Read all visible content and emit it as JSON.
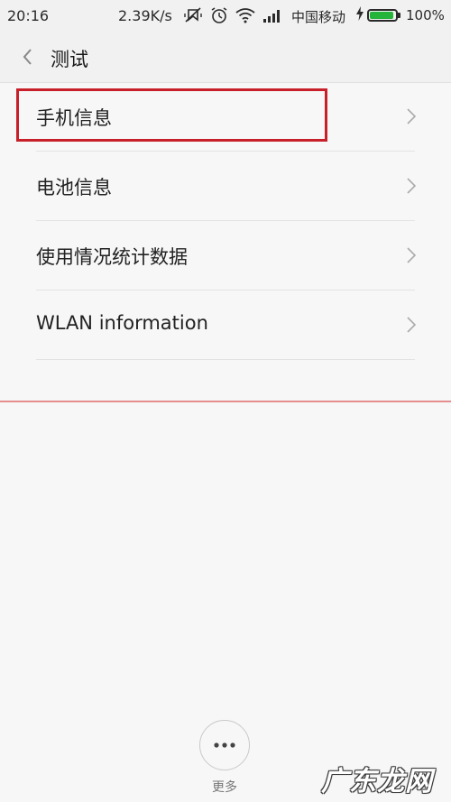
{
  "status_bar": {
    "time": "20:16",
    "speed": "2.39K/s",
    "carrier": "中国移动",
    "battery_percent": "100%",
    "battery_level": 1.0,
    "icons": [
      "mute-vibrate-icon",
      "alarm-icon",
      "wifi-icon",
      "signal-icon",
      "charging-icon"
    ]
  },
  "header": {
    "title": "测试"
  },
  "list": {
    "items": [
      {
        "label": "手机信息"
      },
      {
        "label": "电池信息"
      },
      {
        "label": "使用情况统计数据"
      },
      {
        "label": "WLAN information"
      }
    ],
    "highlighted_index": 0
  },
  "bottom": {
    "more_label": "更多"
  },
  "watermark": {
    "text": "广东龙网"
  },
  "colors": {
    "highlight": "#c8202a",
    "divider_red": "#e58d8f",
    "battery_green": "#24b43a"
  }
}
